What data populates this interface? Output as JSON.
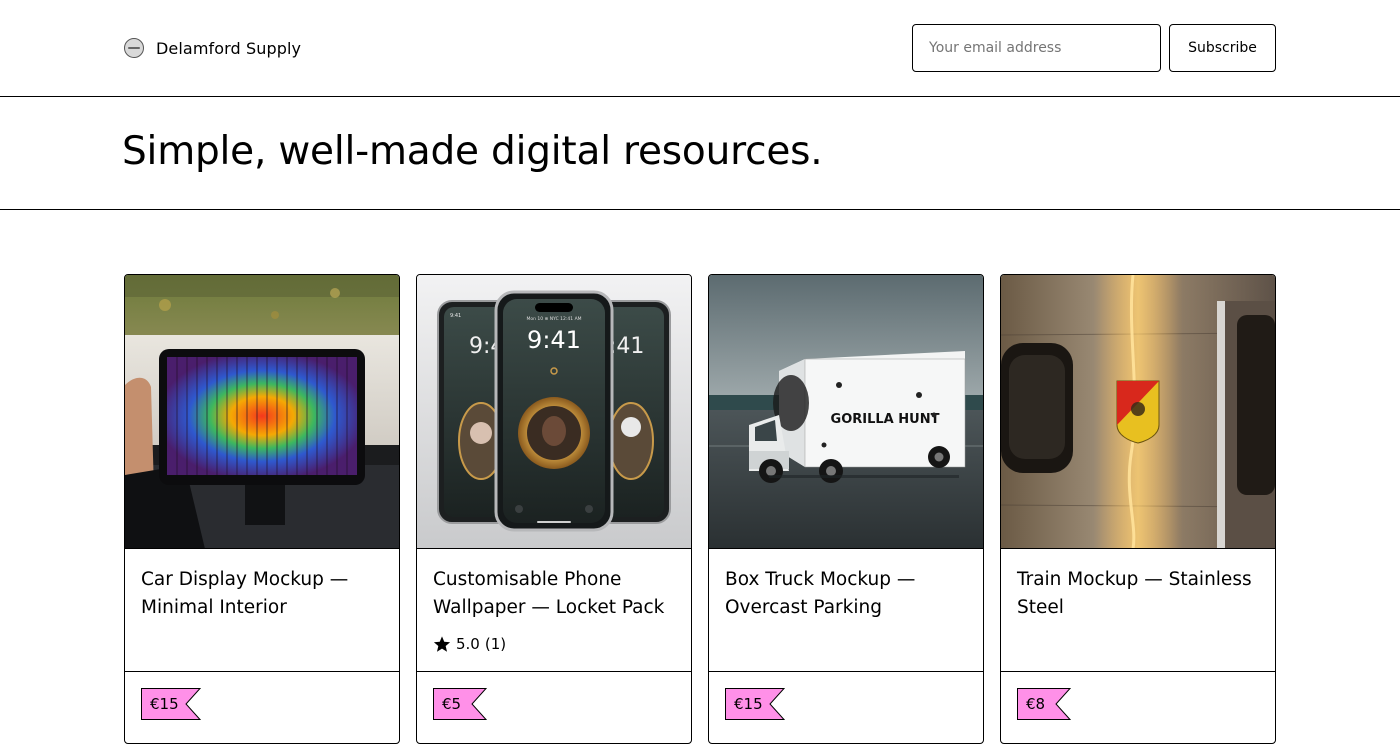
{
  "brand": {
    "name": "Delamford Supply",
    "logo_icon": "logo-badge-icon"
  },
  "newsletter": {
    "email_placeholder": "Your email address",
    "email_value": "",
    "subscribe_label": "Subscribe"
  },
  "hero": {
    "headline": "Simple, well-made digital resources."
  },
  "colors": {
    "price_tag": "#ff90e8",
    "border": "#000000",
    "background": "#ffffff"
  },
  "products": [
    {
      "title": "Car Display Mockup — Minimal Interior",
      "price": "€15",
      "rating": null,
      "image": "car-dashboard-display-photo"
    },
    {
      "title": "Customisable Phone Wallpaper — Locket Pack",
      "price": "€5",
      "rating": {
        "score": "5.0",
        "count": "(1)",
        "icon": "star-icon"
      },
      "image": "phone-lockscreen-mockup-photo"
    },
    {
      "title": "Box Truck Mockup — Overcast Parking",
      "price": "€15",
      "rating": null,
      "image": "box-truck-photo"
    },
    {
      "title": "Train Mockup — Stainless Steel",
      "price": "€8",
      "rating": null,
      "image": "train-car-photo"
    }
  ],
  "image_text": {
    "phone_date": "Mon 10 ⊛ NYC 12:41 AM",
    "phone_time": "9:41",
    "phone_time_left": "9:4",
    "phone_time_right": ":41",
    "phone_status": "9:41",
    "truck_brand": "GORILLA HUNT"
  }
}
